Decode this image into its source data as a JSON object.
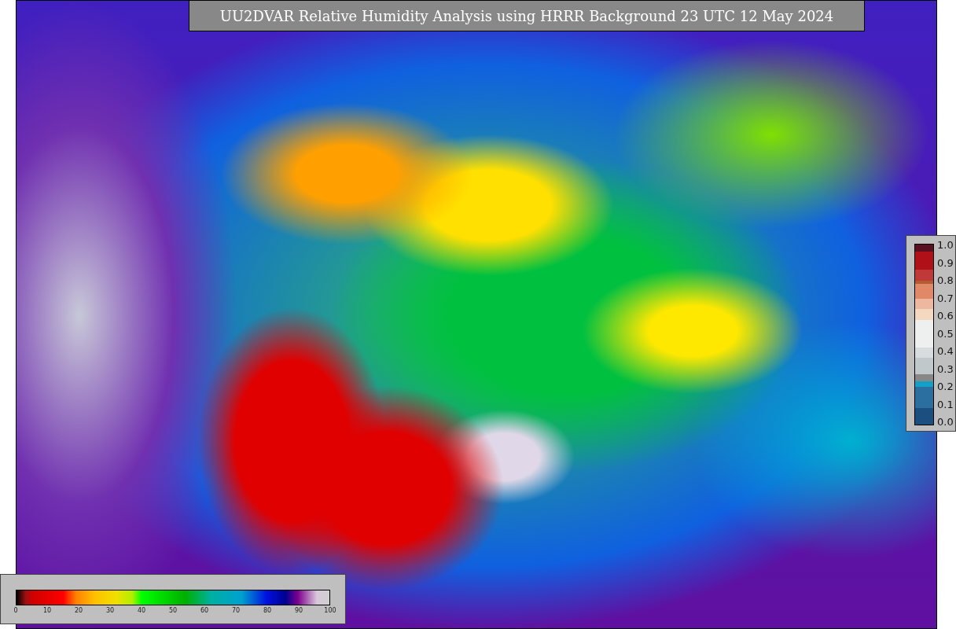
{
  "title": "UU2DVAR Relative Humidity Analysis using HRRR Background 23 UTC 12 May 2024",
  "humidity_colorbar": {
    "ticks": [
      "0",
      "10",
      "20",
      "30",
      "40",
      "50",
      "60",
      "70",
      "80",
      "90",
      "100"
    ]
  },
  "station_colorbar": {
    "ticks": [
      "1.0",
      "0.9",
      "0.8",
      "0.7",
      "0.6",
      "0.5",
      "0.4",
      "0.3",
      "0.2",
      "0.1",
      "0.0"
    ]
  }
}
